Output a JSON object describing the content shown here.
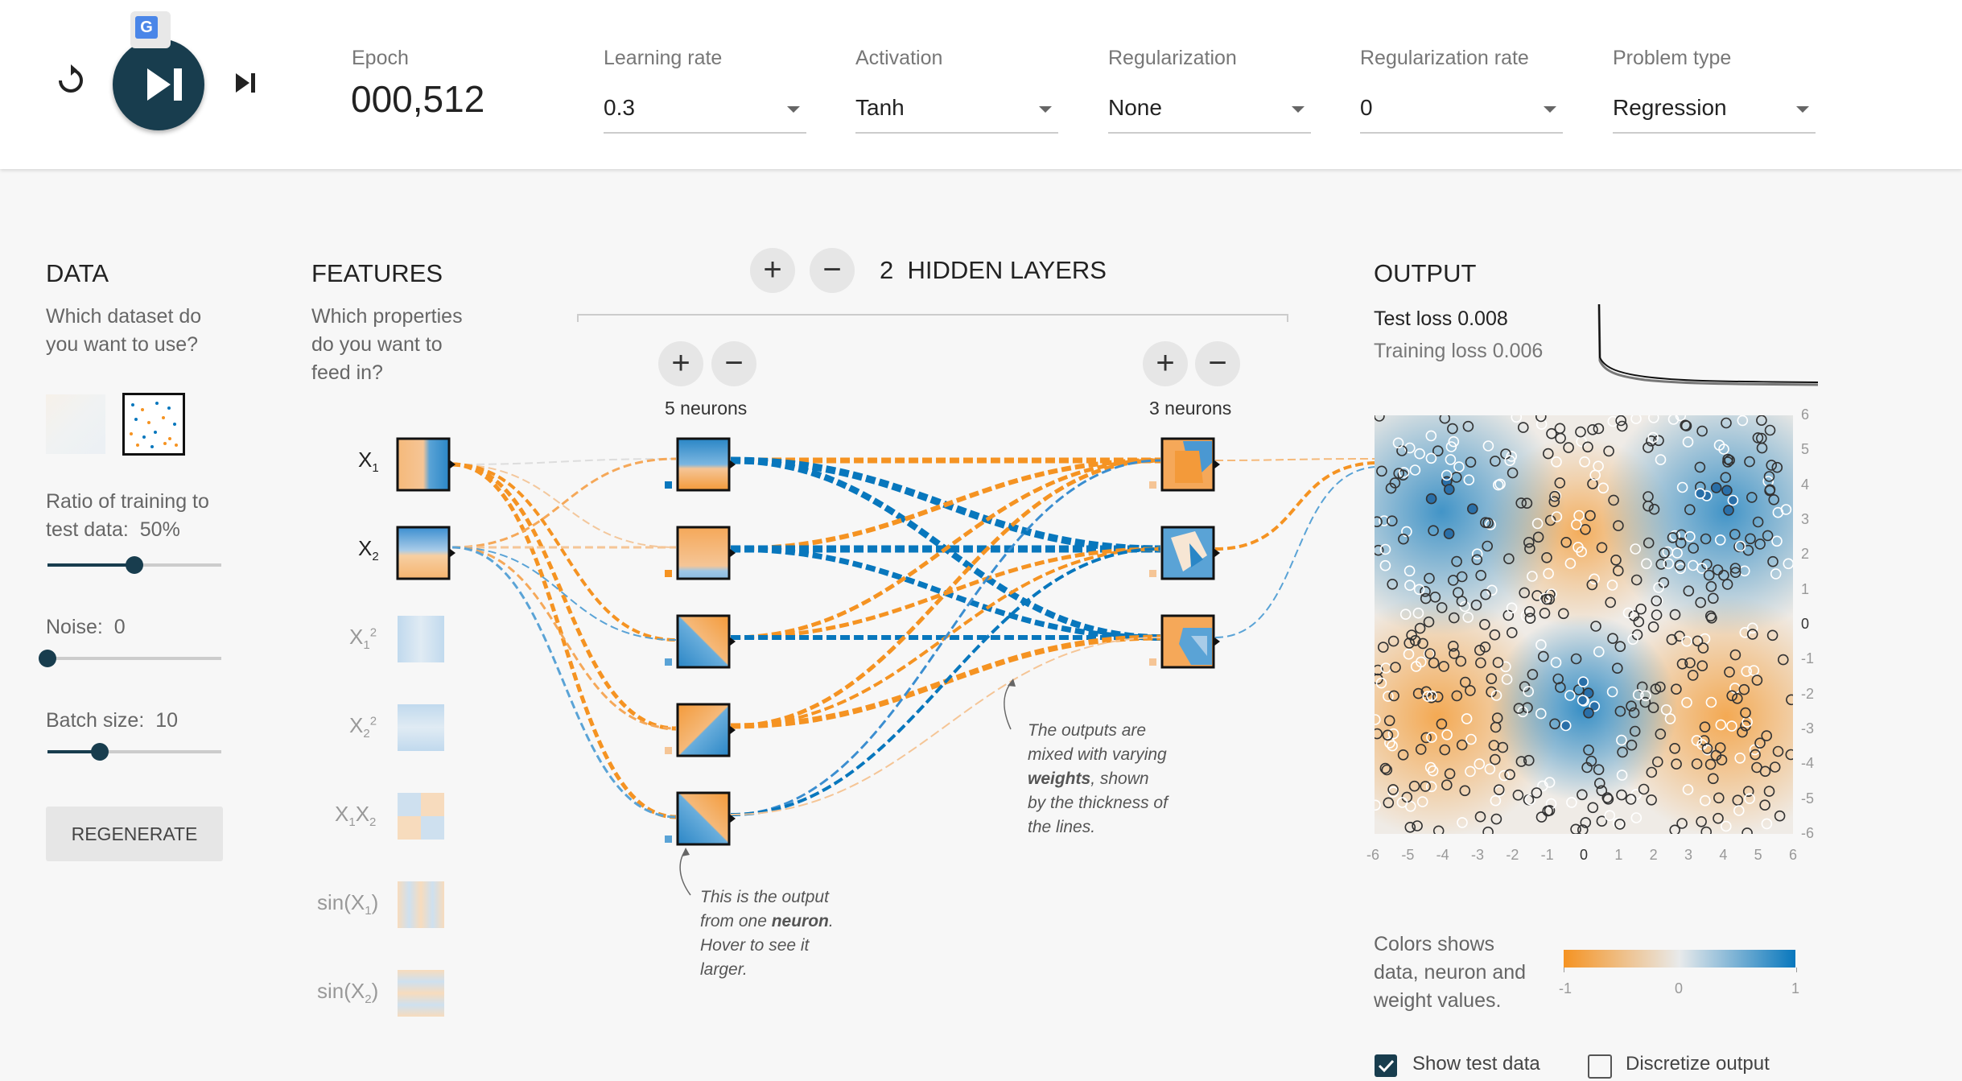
{
  "controls": {
    "reset_icon": "reset-icon",
    "play_icon": "play-pause-icon",
    "step_icon": "step-icon",
    "epoch_label": "Epoch",
    "epoch_value": "000,512",
    "learning_rate": {
      "label": "Learning rate",
      "value": "0.3"
    },
    "activation": {
      "label": "Activation",
      "value": "Tanh"
    },
    "regularization": {
      "label": "Regularization",
      "value": "None"
    },
    "regularization_rate": {
      "label": "Regularization rate",
      "value": "0"
    },
    "problem_type": {
      "label": "Problem type",
      "value": "Regression"
    }
  },
  "data_panel": {
    "title": "DATA",
    "question": [
      "Which dataset do",
      "you want to use?"
    ],
    "ratio_label": "Ratio of training to",
    "ratio_label2": "test data:",
    "ratio_value": "50%",
    "ratio_fraction": 0.5,
    "noise_label": "Noise:",
    "noise_value": "0",
    "noise_fraction": 0,
    "batch_label": "Batch size:",
    "batch_value": "10",
    "batch_fraction": 0.3,
    "regenerate": "REGENERATE"
  },
  "features_panel": {
    "title": "FEATURES",
    "question": [
      "Which properties",
      "do you want to",
      "feed in?"
    ],
    "features": [
      "X1",
      "X2",
      "X1²",
      "X2²",
      "X1X2",
      "sin(X1)",
      "sin(X2)"
    ]
  },
  "network": {
    "hidden_count": "2",
    "hidden_label": "HIDDEN LAYERS",
    "layers": [
      {
        "neurons_label": "5 neurons"
      },
      {
        "neurons_label": "3 neurons"
      }
    ],
    "note_neuron": [
      "This is the output",
      "from one ",
      "neuron",
      ".",
      "Hover to see it",
      "larger."
    ],
    "note_weights": [
      "The outputs are",
      "mixed with varying",
      "weights",
      ", shown",
      "by the thickness of",
      "the lines."
    ]
  },
  "output_panel": {
    "title": "OUTPUT",
    "test_loss": "Test loss 0.008",
    "training_loss": "Training loss 0.006",
    "y_ticks": [
      "6",
      "5",
      "4",
      "3",
      "2",
      "1",
      "0",
      "-1",
      "-2",
      "-3",
      "-4",
      "-5",
      "-6"
    ],
    "x_ticks": [
      "-6",
      "-5",
      "-4",
      "-3",
      "-2",
      "-1",
      "0",
      "1",
      "2",
      "3",
      "4",
      "5",
      "6"
    ],
    "legend_text": [
      "Colors shows",
      "data, neuron and",
      "weight values."
    ],
    "legend_ticks": [
      "-1",
      "0",
      "1"
    ],
    "show_test_data": "Show test data",
    "discretize_output": "Discretize output"
  },
  "colors": {
    "orange": "#f59322",
    "blue": "#0877bd",
    "dark": "#183d4e"
  }
}
